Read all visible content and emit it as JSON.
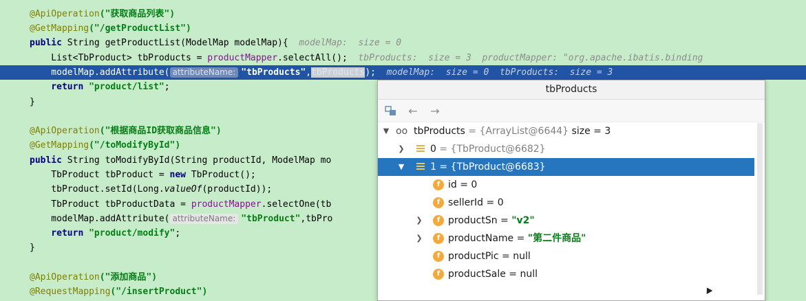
{
  "code": {
    "l1_ann": "@ApiOperation",
    "l1_str": "(\"获取商品列表\")",
    "l2_ann": "@GetMapping",
    "l2_str": "(\"/getProductList\")",
    "l3_kw": "public",
    "l3_code": " String getProductList(ModelMap modelMap){",
    "l3_hint": "  modelMap:  size = 0",
    "l4_code": "    List<TbProduct> tbProducts = ",
    "l4_fld": "productMapper",
    "l4_code2": ".selectAll();",
    "l4_hint": "  tbProducts:  size = 3  productMapper: \"org.apache.ibatis.binding",
    "l5_code": "    modelMap.addAttribute(",
    "l5_param": "attributeName:",
    "l5_str": "\"tbProducts\"",
    "l5_comma": ",",
    "l5_sel": "tbProducts",
    "l5_end": ");",
    "l5_hint": "  modelMap:  size = 0  tbProducts:  size = 3",
    "l6_kw": "    return",
    "l6_str": " \"product/list\"",
    "l6_end": ";",
    "l7": "}",
    "l9_ann": "@ApiOperation",
    "l9_str": "(\"根据商品ID获取商品信息\")",
    "l10_ann": "@GetMapping",
    "l10_str": "(\"/toModifyById\")",
    "l11_kw": "public",
    "l11_code": " String toModifyById(String productId, ModelMap mo",
    "l12_code": "    TbProduct tbProduct = ",
    "l12_kw": "new",
    "l12_code2": " TbProduct();",
    "l13_code": "    tbProduct.setId(Long.",
    "l13_it": "valueOf",
    "l13_code2": "(productId));",
    "l14_code": "    TbProduct tbProductData = ",
    "l14_fld": "productMapper",
    "l14_code2": ".selectOne(tb",
    "l15_code": "    modelMap.addAttribute(",
    "l15_param": "attributeName:",
    "l15_str": "\"tbProduct\"",
    "l15_code2": ",tbPro",
    "l16_kw": "    return",
    "l16_str": " \"product/modify\"",
    "l16_end": ";",
    "l17": "}",
    "l19_ann": "@ApiOperation",
    "l19_str": "(\"添加商品\")",
    "l20_ann": "@RequestMapping",
    "l20_str": "(\"/insertProduct\")"
  },
  "popup": {
    "title": "tbProducts",
    "rows": {
      "root_name": "tbProducts",
      "root_val": " = {ArrayList@6644}",
      "root_size": " size = 3",
      "item0_name": "0",
      "item0_val": " = {TbProduct@6682}",
      "item1_name": "1",
      "item1_val": " = {TbProduct@6683}",
      "id_name": "id",
      "id_val": " = 0",
      "sellerId_name": "sellerId",
      "sellerId_val": " = 0",
      "productSn_name": "productSn",
      "productSn_eq": " = ",
      "productSn_val": "\"v2\"",
      "productName_name": "productName",
      "productName_eq": " = ",
      "productName_val": "\"第二件商品\"",
      "productPic_name": "productPic",
      "productPic_val": " = null",
      "productSale_name": "productSale",
      "productSale_val": " = null"
    }
  }
}
